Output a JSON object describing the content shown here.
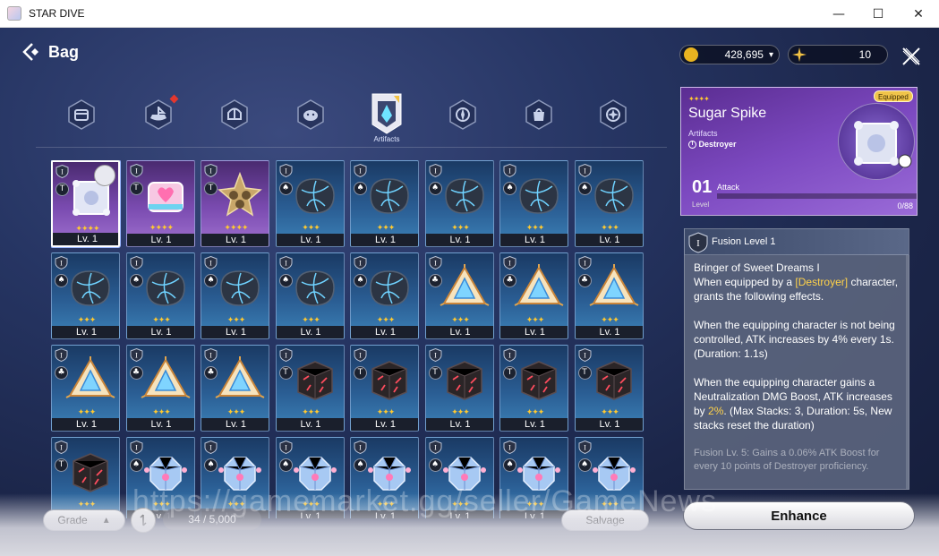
{
  "window": {
    "title": "STAR DIVE",
    "minimize": "—",
    "maximize": "☐",
    "close": "✕"
  },
  "header": {
    "back_label": "Bag"
  },
  "currencies": [
    {
      "icon": "gold-coin-icon",
      "value": "428,695",
      "arrow": "▾",
      "color": "#e8b320"
    },
    {
      "icon": "star-crystal-icon",
      "value": "10",
      "color": "#f2c244"
    }
  ],
  "tabs": [
    {
      "name": "tab-1",
      "icon": "chest-icon"
    },
    {
      "name": "tab-2",
      "icon": "boat-icon",
      "notification": true
    },
    {
      "name": "tab-3",
      "icon": "helmet-icon"
    },
    {
      "name": "tab-4",
      "icon": "blob-icon"
    },
    {
      "name": "tab-artifacts",
      "icon": "artifact-icon",
      "label": "Artifacts",
      "active": true
    },
    {
      "name": "tab-6",
      "icon": "compass-icon"
    },
    {
      "name": "tab-7",
      "icon": "bag-icon"
    },
    {
      "name": "tab-8",
      "icon": "star-gear-icon"
    }
  ],
  "items": [
    {
      "art": "cube-white",
      "bg": "purple",
      "stars": 4,
      "level": "Lv. 1",
      "selected": true,
      "equipped": true,
      "type": "T"
    },
    {
      "art": "cube-pink",
      "bg": "purple",
      "stars": 4,
      "level": "Lv. 1",
      "type": "T"
    },
    {
      "art": "star-gold",
      "bg": "purple",
      "stars": 4,
      "level": "Lv. 1",
      "type": "T"
    },
    {
      "art": "rock-blue",
      "bg": "blue",
      "stars": 3,
      "level": "Lv. 1",
      "type": "♠"
    },
    {
      "art": "rock-blue",
      "bg": "blue",
      "stars": 3,
      "level": "Lv. 1",
      "type": "♠"
    },
    {
      "art": "rock-blue",
      "bg": "blue",
      "stars": 3,
      "level": "Lv. 1",
      "type": "♠"
    },
    {
      "art": "rock-blue",
      "bg": "blue",
      "stars": 3,
      "level": "Lv. 1",
      "type": "♠"
    },
    {
      "art": "rock-blue",
      "bg": "blue",
      "stars": 3,
      "level": "Lv. 1",
      "type": "♠"
    },
    {
      "art": "rock-blue",
      "bg": "blue",
      "stars": 3,
      "level": "Lv. 1",
      "type": "♠"
    },
    {
      "art": "rock-blue",
      "bg": "blue",
      "stars": 3,
      "level": "Lv. 1",
      "type": "♠"
    },
    {
      "art": "rock-blue",
      "bg": "blue",
      "stars": 3,
      "level": "Lv. 1",
      "type": "♠"
    },
    {
      "art": "rock-blue",
      "bg": "blue",
      "stars": 3,
      "level": "Lv. 1",
      "type": "♠"
    },
    {
      "art": "rock-blue",
      "bg": "blue",
      "stars": 3,
      "level": "Lv. 1",
      "type": "♠"
    },
    {
      "art": "pyramid",
      "bg": "blue",
      "stars": 3,
      "level": "Lv. 1",
      "type": "♣"
    },
    {
      "art": "pyramid",
      "bg": "blue",
      "stars": 3,
      "level": "Lv. 1",
      "type": "♣"
    },
    {
      "art": "pyramid",
      "bg": "blue",
      "stars": 3,
      "level": "Lv. 1",
      "type": "♣"
    },
    {
      "art": "pyramid",
      "bg": "blue",
      "stars": 3,
      "level": "Lv. 1",
      "type": "♣"
    },
    {
      "art": "pyramid",
      "bg": "blue",
      "stars": 3,
      "level": "Lv. 1",
      "type": "♣"
    },
    {
      "art": "pyramid",
      "bg": "blue",
      "stars": 3,
      "level": "Lv. 1",
      "type": "♣"
    },
    {
      "art": "cube-dark",
      "bg": "blue",
      "stars": 3,
      "level": "Lv. 1",
      "type": "T"
    },
    {
      "art": "cube-dark",
      "bg": "blue",
      "stars": 3,
      "level": "Lv. 1",
      "type": "T"
    },
    {
      "art": "cube-dark",
      "bg": "blue",
      "stars": 3,
      "level": "Lv. 1",
      "type": "T"
    },
    {
      "art": "cube-dark",
      "bg": "blue",
      "stars": 3,
      "level": "Lv. 1",
      "type": "T"
    },
    {
      "art": "cube-dark",
      "bg": "blue",
      "stars": 3,
      "level": "Lv. 1",
      "type": "T"
    },
    {
      "art": "cube-dark",
      "bg": "blue",
      "stars": 3,
      "level": "Lv. 1",
      "type": "T"
    },
    {
      "art": "crystal",
      "bg": "blue",
      "stars": 3,
      "level": "Lv. 1",
      "type": "♠"
    },
    {
      "art": "crystal",
      "bg": "blue",
      "stars": 3,
      "level": "Lv. 1",
      "type": "♠"
    },
    {
      "art": "crystal",
      "bg": "blue",
      "stars": 3,
      "level": "Lv. 1",
      "type": "♠"
    },
    {
      "art": "crystal",
      "bg": "blue",
      "stars": 3,
      "level": "Lv. 1",
      "type": "♠"
    },
    {
      "art": "crystal",
      "bg": "blue",
      "stars": 3,
      "level": "Lv. 1",
      "type": "♠"
    },
    {
      "art": "crystal",
      "bg": "blue",
      "stars": 3,
      "level": "Lv. 1",
      "type": "♠"
    },
    {
      "art": "crystal",
      "bg": "blue",
      "stars": 3,
      "level": "Lv. 1",
      "type": "♠"
    }
  ],
  "bottom": {
    "grade_label": "Grade",
    "grade_arrow": "▲",
    "filter_icon": "swap-icon",
    "count": "34 / 5,000",
    "salvage_label": "Salvage"
  },
  "watermark": "https://gamemarket.gg/seller/GameNews",
  "detail": {
    "rarity_stars": 4,
    "name": "Sugar Spike",
    "category": "Artifacts",
    "class": "Destroyer",
    "equipped_label": "Equipped",
    "level": "01",
    "level_label": "Level",
    "stat_label": "Attack",
    "xp_text": "0/88",
    "xp_progress": 0.0
  },
  "fusion": {
    "title": "Fusion Level 1",
    "icon_text": "I",
    "effect_title": "Bringer of Sweet Dreams  I",
    "p1_pre": "When equipped by a ",
    "p1_hl": "[Destroyer]",
    "p1_post": " character, grants the following effects.",
    "p2": "When the equipping character is not being controlled, ATK increases by 4% every 1s. (Duration: 1.1s)",
    "p3_pre": "When the equipping character gains a Neutralization DMG Boost, ATK increases by ",
    "p3_hl": "2%",
    "p3_post": ". (Max Stacks: 3, Duration: 5s, New stacks reset the duration)",
    "p4": "Fusion Lv. 5: Gains a 0.06% ATK Boost for every 10 points of Destroyer proficiency."
  },
  "enhance_label": "Enhance"
}
